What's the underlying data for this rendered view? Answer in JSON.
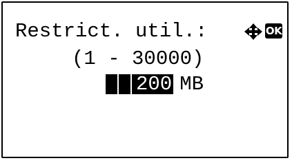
{
  "screen": {
    "title": "Restrict. util.:",
    "range": "(1 - 30000)",
    "value": "200",
    "unit": "MB"
  },
  "icons": {
    "navigate": "four-way-arrow-icon",
    "ok": "OK"
  }
}
